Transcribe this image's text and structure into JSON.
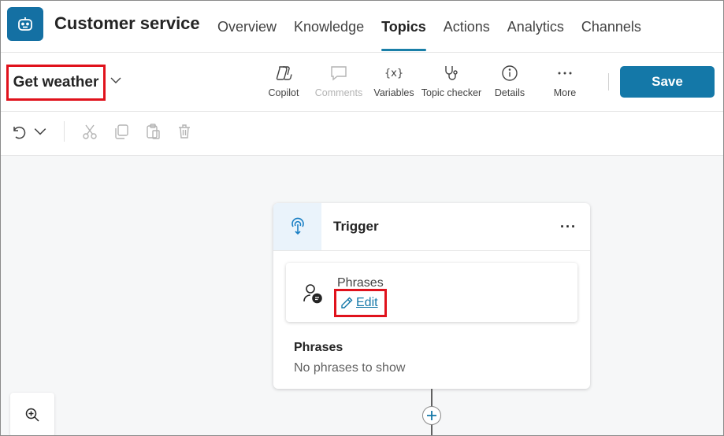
{
  "app": {
    "title": "Customer service",
    "logo_icon": "bot-icon",
    "brand_color": "#1470a3"
  },
  "nav": {
    "tabs": [
      {
        "label": "Overview",
        "active": false
      },
      {
        "label": "Knowledge",
        "active": false
      },
      {
        "label": "Topics",
        "active": true
      },
      {
        "label": "Actions",
        "active": false
      },
      {
        "label": "Analytics",
        "active": false
      },
      {
        "label": "Channels",
        "active": false
      }
    ]
  },
  "toolbar": {
    "topic_name": "Get weather",
    "tools": [
      {
        "label": "Copilot",
        "icon": "copilot-icon",
        "enabled": true
      },
      {
        "label": "Comments",
        "icon": "comment-icon",
        "enabled": false
      },
      {
        "label": "Variables",
        "icon": "variables-icon",
        "enabled": true
      },
      {
        "label": "Topic checker",
        "icon": "stethoscope-icon",
        "enabled": true
      },
      {
        "label": "Details",
        "icon": "info-icon",
        "enabled": true
      },
      {
        "label": "More",
        "icon": "more-icon",
        "enabled": true
      }
    ],
    "save_label": "Save",
    "save_color": "#1478a8"
  },
  "editbar": {
    "icons": [
      "undo-icon",
      "chevron-down-icon",
      "cut-icon",
      "copy-icon",
      "paste-icon",
      "delete-icon"
    ]
  },
  "canvas": {
    "trigger_node": {
      "title": "Trigger",
      "more_label": "···",
      "phrases_card": {
        "title": "Phrases",
        "edit_label": "Edit"
      },
      "phrases_label": "Phrases",
      "phrases_empty": "No phrases to show"
    },
    "add_node_label": "+",
    "highlight_color": "#e0121c"
  }
}
